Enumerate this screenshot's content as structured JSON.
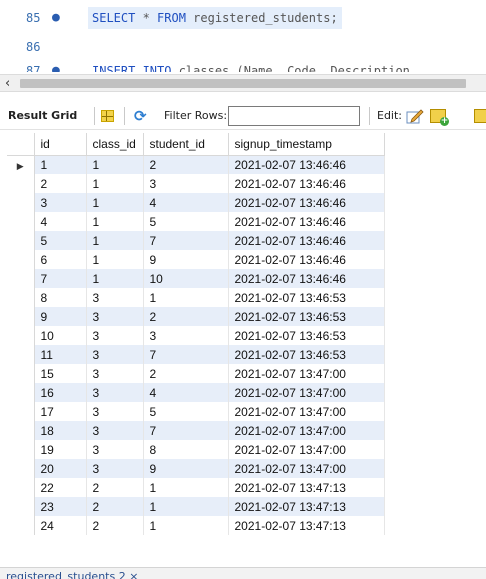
{
  "editor": {
    "lines": [
      {
        "number": "85",
        "breakpoint": "●",
        "tokens": [
          {
            "text": "SELECT",
            "kind": "kw"
          },
          {
            "text": " * ",
            "kind": "cd"
          },
          {
            "text": "FROM",
            "kind": "kw"
          },
          {
            "text": " registered_students;",
            "kind": "cd"
          }
        ]
      },
      {
        "number": "86",
        "breakpoint": "",
        "tokens": []
      },
      {
        "number": "87",
        "breakpoint": "●",
        "tokens": [
          {
            "text": "INSERT INTO",
            "kind": "kw"
          },
          {
            "text": " classes (Name, Code, Description",
            "kind": "cd"
          }
        ]
      }
    ],
    "scroll_left_arrow": "‹"
  },
  "toolbar": {
    "result_grid_label": "Result Grid",
    "filter_label": "Filter Rows:",
    "filter_value": "",
    "edit_label": "Edit:",
    "refresh_glyph": "⟳"
  },
  "grid": {
    "columns": [
      "id",
      "class_id",
      "student_id",
      "signup_timestamp"
    ],
    "current_row_marker": "▶",
    "rows": [
      [
        "1",
        "1",
        "2",
        "2021-02-07 13:46:46"
      ],
      [
        "2",
        "1",
        "3",
        "2021-02-07 13:46:46"
      ],
      [
        "3",
        "1",
        "4",
        "2021-02-07 13:46:46"
      ],
      [
        "4",
        "1",
        "5",
        "2021-02-07 13:46:46"
      ],
      [
        "5",
        "1",
        "7",
        "2021-02-07 13:46:46"
      ],
      [
        "6",
        "1",
        "9",
        "2021-02-07 13:46:46"
      ],
      [
        "7",
        "1",
        "10",
        "2021-02-07 13:46:46"
      ],
      [
        "8",
        "3",
        "1",
        "2021-02-07 13:46:53"
      ],
      [
        "9",
        "3",
        "2",
        "2021-02-07 13:46:53"
      ],
      [
        "10",
        "3",
        "3",
        "2021-02-07 13:46:53"
      ],
      [
        "11",
        "3",
        "7",
        "2021-02-07 13:46:53"
      ],
      [
        "15",
        "3",
        "2",
        "2021-02-07 13:47:00"
      ],
      [
        "16",
        "3",
        "4",
        "2021-02-07 13:47:00"
      ],
      [
        "17",
        "3",
        "5",
        "2021-02-07 13:47:00"
      ],
      [
        "18",
        "3",
        "7",
        "2021-02-07 13:47:00"
      ],
      [
        "19",
        "3",
        "8",
        "2021-02-07 13:47:00"
      ],
      [
        "20",
        "3",
        "9",
        "2021-02-07 13:47:00"
      ],
      [
        "22",
        "2",
        "1",
        "2021-02-07 13:47:13"
      ],
      [
        "23",
        "2",
        "1",
        "2021-02-07 13:47:13"
      ],
      [
        "24",
        "2",
        "1",
        "2021-02-07 13:47:13"
      ]
    ]
  },
  "tabs": [
    {
      "label": "registered_students 2 ×"
    }
  ],
  "colors": {
    "row_highlight": "#e7eef9",
    "keyword": "#1f4fc0",
    "line_number": "#3a6fb0"
  }
}
